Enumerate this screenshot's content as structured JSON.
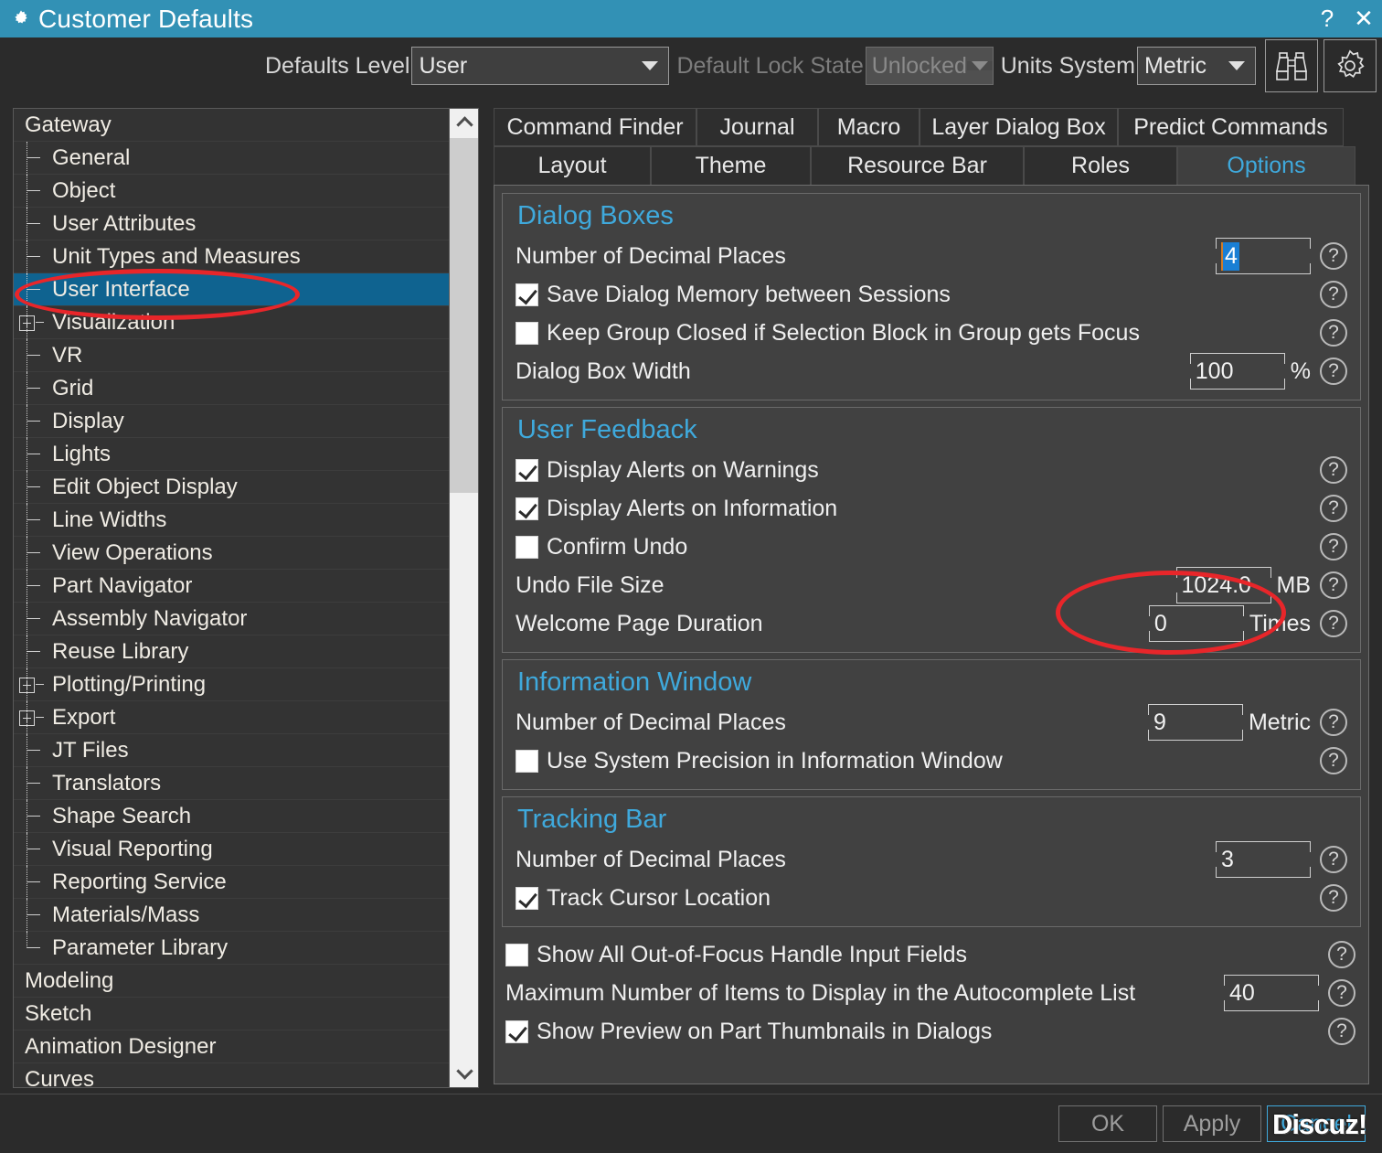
{
  "window": {
    "title": "Customer Defaults",
    "gear_icon": "gear-icon",
    "help_button": "?",
    "close_button": "✕"
  },
  "toolbar": {
    "defaults_level_label": "Defaults Level",
    "defaults_level_value": "User",
    "lock_state_label": "Default Lock State",
    "lock_state_value": "Unlocked",
    "units_system_label": "Units System",
    "units_system_value": "Metric",
    "find_icon": "binoculars-icon",
    "settings_icon": "gear-icon"
  },
  "tree": {
    "items": [
      {
        "label": "Gateway",
        "level": 0,
        "type": "root",
        "selected": false
      },
      {
        "label": "General",
        "level": 1,
        "type": "leaf",
        "selected": false
      },
      {
        "label": "Object",
        "level": 1,
        "type": "leaf",
        "selected": false
      },
      {
        "label": "User Attributes",
        "level": 1,
        "type": "leaf",
        "selected": false
      },
      {
        "label": "Unit Types and Measures",
        "level": 1,
        "type": "leaf",
        "selected": false
      },
      {
        "label": "User Interface",
        "level": 1,
        "type": "leaf",
        "selected": true
      },
      {
        "label": "Visualization",
        "level": 1,
        "type": "expand",
        "selected": false
      },
      {
        "label": "VR",
        "level": 1,
        "type": "leaf",
        "selected": false
      },
      {
        "label": "Grid",
        "level": 1,
        "type": "leaf",
        "selected": false
      },
      {
        "label": "Display",
        "level": 1,
        "type": "leaf",
        "selected": false
      },
      {
        "label": "Lights",
        "level": 1,
        "type": "leaf",
        "selected": false
      },
      {
        "label": "Edit Object Display",
        "level": 1,
        "type": "leaf",
        "selected": false
      },
      {
        "label": "Line Widths",
        "level": 1,
        "type": "leaf",
        "selected": false
      },
      {
        "label": "View Operations",
        "level": 1,
        "type": "leaf",
        "selected": false
      },
      {
        "label": "Part Navigator",
        "level": 1,
        "type": "leaf",
        "selected": false
      },
      {
        "label": "Assembly Navigator",
        "level": 1,
        "type": "leaf",
        "selected": false
      },
      {
        "label": "Reuse Library",
        "level": 1,
        "type": "leaf",
        "selected": false
      },
      {
        "label": "Plotting/Printing",
        "level": 1,
        "type": "expand",
        "selected": false
      },
      {
        "label": "Export",
        "level": 1,
        "type": "expand",
        "selected": false
      },
      {
        "label": "JT Files",
        "level": 1,
        "type": "leaf",
        "selected": false
      },
      {
        "label": "Translators",
        "level": 1,
        "type": "leaf",
        "selected": false
      },
      {
        "label": "Shape Search",
        "level": 1,
        "type": "leaf",
        "selected": false
      },
      {
        "label": "Visual Reporting",
        "level": 1,
        "type": "leaf",
        "selected": false
      },
      {
        "label": "Reporting Service",
        "level": 1,
        "type": "leaf",
        "selected": false
      },
      {
        "label": "Materials/Mass",
        "level": 1,
        "type": "leaf",
        "selected": false
      },
      {
        "label": "Parameter Library",
        "level": 1,
        "type": "last",
        "selected": false
      },
      {
        "label": "Modeling",
        "level": 0,
        "type": "root",
        "selected": false
      },
      {
        "label": "Sketch",
        "level": 0,
        "type": "root",
        "selected": false
      },
      {
        "label": "Animation Designer",
        "level": 0,
        "type": "root",
        "selected": false
      },
      {
        "label": "Curves",
        "level": 0,
        "type": "root",
        "selected": false
      }
    ]
  },
  "tabs_row1": [
    {
      "label": "Command Finder",
      "active": false
    },
    {
      "label": "Journal",
      "active": false
    },
    {
      "label": "Macro",
      "active": false
    },
    {
      "label": "Layer Dialog Box",
      "active": false
    },
    {
      "label": "Predict Commands",
      "active": false
    }
  ],
  "tabs_row2": [
    {
      "label": "Layout",
      "active": false
    },
    {
      "label": "Theme",
      "active": false
    },
    {
      "label": "Resource Bar",
      "active": false
    },
    {
      "label": "Roles",
      "active": false
    },
    {
      "label": "Options",
      "active": true
    }
  ],
  "dialog_boxes": {
    "title": "Dialog Boxes",
    "decimal_places_label": "Number of Decimal Places",
    "decimal_places_value": "4",
    "save_memory_label": "Save Dialog Memory between Sessions",
    "save_memory_checked": true,
    "keep_group_label": "Keep Group Closed if Selection Block in Group gets Focus",
    "keep_group_checked": false,
    "width_label": "Dialog Box Width",
    "width_value": "100",
    "width_unit": "%"
  },
  "user_feedback": {
    "title": "User Feedback",
    "alerts_warnings_label": "Display Alerts on Warnings",
    "alerts_warnings_checked": true,
    "alerts_information_label": "Display Alerts on Information",
    "alerts_information_checked": true,
    "confirm_undo_label": "Confirm Undo",
    "confirm_undo_checked": false,
    "undo_file_size_label": "Undo File Size",
    "undo_file_size_value": "1024.0",
    "undo_file_size_unit": "MB",
    "welcome_duration_label": "Welcome Page Duration",
    "welcome_duration_value": "0",
    "welcome_duration_unit": "Times"
  },
  "information_window": {
    "title": "Information Window",
    "decimal_places_label": "Number of Decimal Places",
    "decimal_places_value": "9",
    "decimal_places_unit": "Metric",
    "system_precision_label": "Use System Precision in Information Window",
    "system_precision_checked": false
  },
  "tracking_bar": {
    "title": "Tracking Bar",
    "decimal_places_label": "Number of Decimal Places",
    "decimal_places_value": "3",
    "track_cursor_label": "Track Cursor Location",
    "track_cursor_checked": true
  },
  "misc": {
    "out_of_focus_label": "Show All Out-of-Focus Handle Input Fields",
    "out_of_focus_checked": false,
    "autocomplete_label": "Maximum Number of Items to Display in the Autocomplete List",
    "autocomplete_value": "40",
    "preview_thumbnails_label": "Show Preview on Part Thumbnails in Dialogs",
    "preview_thumbnails_checked": true
  },
  "footer": {
    "ok_label": "OK",
    "apply_label": "Apply",
    "cancel_label": "Cancel",
    "watermark": "Discuz!"
  },
  "help_symbol": "?",
  "colors": {
    "titlebar": "#3291b5",
    "accent": "#3fa9dc",
    "selection": "#0f6390",
    "annotation": "#e8262a",
    "text_selection": "#1a7fd4"
  }
}
